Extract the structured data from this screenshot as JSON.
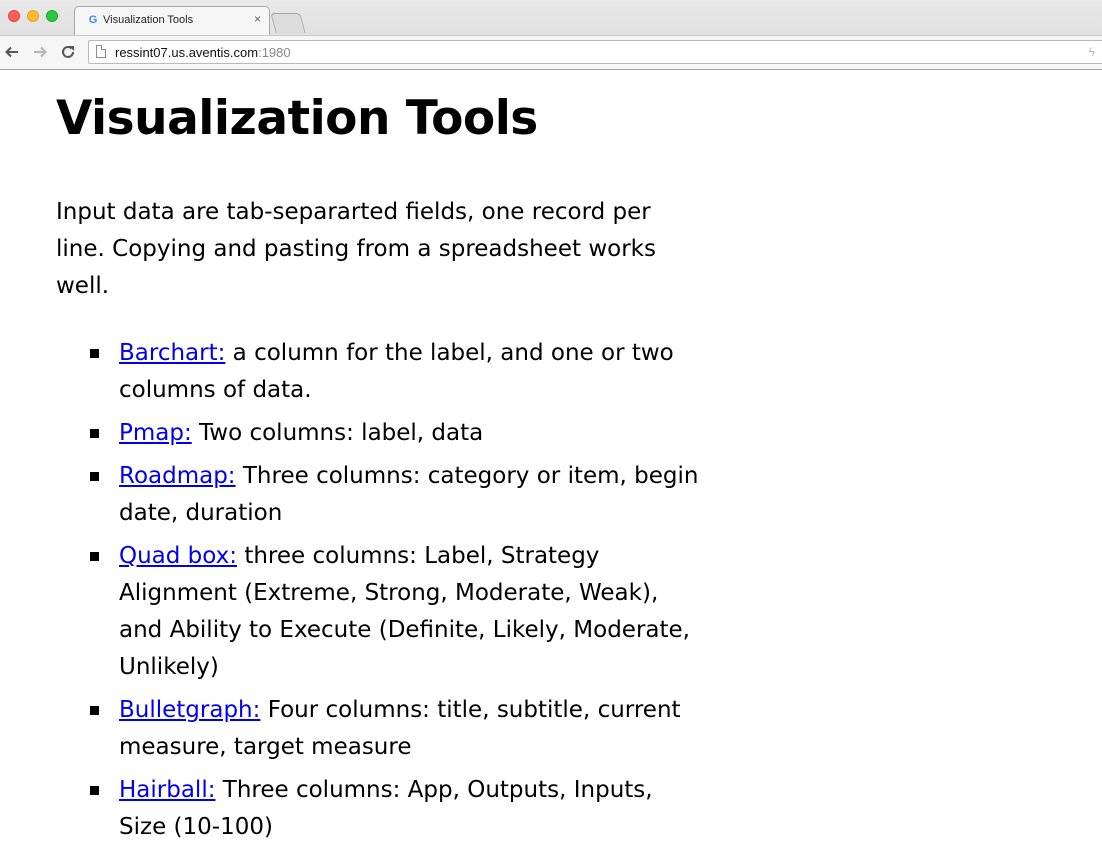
{
  "browser": {
    "tab_title": "Visualization Tools",
    "tab_favicon": "G",
    "tab_close": "×",
    "url_host": "ressint07.us.aventis.com",
    "url_port": ":1980",
    "icons": {
      "back": "arrow-left-icon",
      "forward": "arrow-right-icon",
      "reload": "reload-icon",
      "page": "page-icon",
      "bolt": "bolt-icon"
    }
  },
  "page": {
    "title": "Visualization Tools",
    "intro": "Input data are tab-separarted fields, one record per line. Copying and pasting from a spreadsheet works well.",
    "tools": [
      {
        "link": "Barchart:",
        "desc": " a column for the label, and one or two columns of data."
      },
      {
        "link": "Pmap:",
        "desc": " Two columns: label, data"
      },
      {
        "link": "Roadmap:",
        "desc": " Three columns: category or item, begin date, duration"
      },
      {
        "link": "Quad box:",
        "desc": " three columns: Label, Strategy Alignment (Extreme, Strong, Moderate, Weak), and Ability to Execute (Definite, Likely, Moderate, Unlikely)"
      },
      {
        "link": "Bulletgraph:",
        "desc": " Four columns: title, subtitle, current measure, target measure"
      },
      {
        "link": "Hairball:",
        "desc": " Three columns: App, Outputs, Inputs, Size (10-100)"
      }
    ]
  },
  "colors": {
    "link": "#0000ee",
    "text": "#000000",
    "background": "#ffffff"
  }
}
